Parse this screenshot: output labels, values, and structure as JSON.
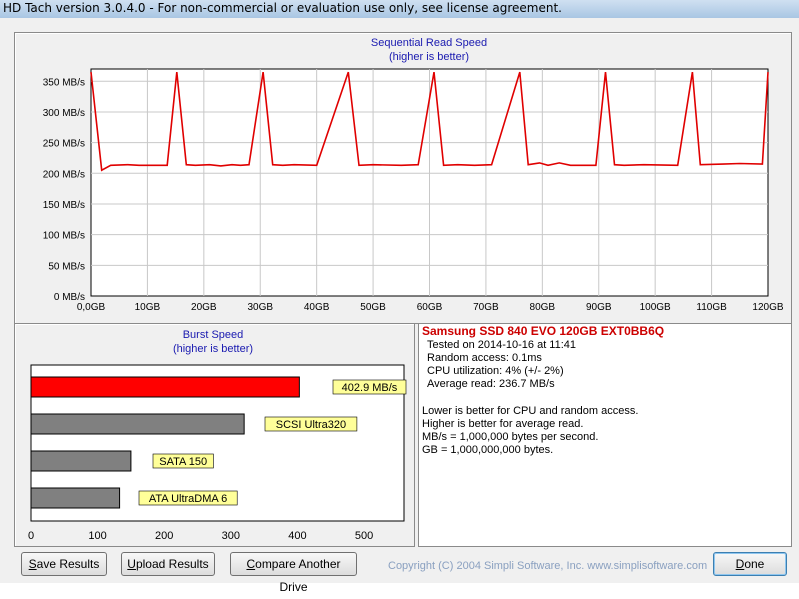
{
  "window": {
    "title": "HD Tach version 3.0.4.0  - For non-commercial or evaluation use only, see license agreement."
  },
  "sequential": {
    "title": "Sequential Read Speed",
    "subtitle": "(higher is better)"
  },
  "burst": {
    "title": "Burst Speed",
    "subtitle": "(higher is better)",
    "bars": [
      {
        "label": "402.9 MB/s",
        "value": 402.9,
        "color": "#ff0000"
      },
      {
        "label": "SCSI Ultra320",
        "value": 320,
        "color": "#808080"
      },
      {
        "label": "SATA 150",
        "value": 150,
        "color": "#808080"
      },
      {
        "label": "ATA UltraDMA 6",
        "value": 133,
        "color": "#808080"
      }
    ],
    "xticks": [
      "0",
      "100",
      "200",
      "300",
      "400",
      "500"
    ],
    "xmax": 560
  },
  "info": {
    "drive_name": "Samsung SSD 840 EVO 120GB EXT0BB6Q",
    "tested_on": "Tested on 2014-10-16 at 11:41",
    "random_access": "Random access: 0.1ms",
    "cpu_util": "CPU utilization: 4% (+/- 2%)",
    "average_read": "Average read: 236.7 MB/s",
    "note1": "Lower is better for CPU and random access.",
    "note2": "Higher is better for average read.",
    "note3": "MB/s = 1,000,000 bytes per second.",
    "note4": "GB = 1,000,000,000 bytes."
  },
  "buttons": {
    "save_prefix": "S",
    "save_rest": "ave Results",
    "upload_prefix": "U",
    "upload_rest": "pload Results",
    "compare_prefix": "C",
    "compare_rest": "ompare Another Drive",
    "done_prefix": "D",
    "done_rest": "one"
  },
  "copyright": "Copyright (C) 2004 Simpli Software, Inc. www.simplisoftware.com",
  "colors": {
    "line": "#e00000",
    "label_blue": "#1a1ab0",
    "burst_label_bg": "#ffff99"
  },
  "chart_data": [
    {
      "type": "line",
      "title": "Sequential Read Speed",
      "subtitle": "(higher is better)",
      "ylabel": "",
      "xlabel": "",
      "y_ticks": [
        "0 MB/s",
        "50 MB/s",
        "100 MB/s",
        "150 MB/s",
        "200 MB/s",
        "250 MB/s",
        "300 MB/s",
        "350 MB/s"
      ],
      "x_ticks": [
        "0,0GB",
        "10GB",
        "20GB",
        "30GB",
        "40GB",
        "50GB",
        "60GB",
        "70GB",
        "80GB",
        "90GB",
        "100GB",
        "110GB",
        "120GB"
      ],
      "xlim": [
        0,
        120
      ],
      "ylim": [
        0,
        370
      ],
      "grid": true,
      "series": [
        {
          "x": [
            0,
            1.9,
            3.5,
            6.5,
            8.5,
            13.5,
            15.2,
            16.9,
            18.5,
            21,
            23,
            25,
            26.5,
            28,
            30.5,
            32.2,
            34,
            36,
            40,
            45.6,
            47.5,
            50,
            55,
            58,
            60.8,
            62.5,
            65,
            68,
            71,
            76,
            77.5,
            79.5,
            81,
            83,
            85,
            89.5,
            91.2,
            92.8,
            94.5,
            98,
            104,
            106.6,
            108,
            112,
            115,
            119,
            120
          ],
          "y": [
            365,
            205,
            213,
            214,
            213,
            213,
            365,
            214,
            213,
            214,
            212,
            214,
            213,
            214,
            365,
            214,
            213,
            214,
            213,
            365,
            213,
            214,
            213,
            214,
            365,
            213,
            214,
            213,
            214,
            365,
            214,
            217,
            213,
            217,
            213,
            213,
            365,
            214,
            213,
            214,
            213,
            365,
            214,
            215,
            216,
            215,
            365
          ]
        }
      ]
    },
    {
      "type": "bar",
      "title": "Burst Speed",
      "subtitle": "(higher is better)",
      "orientation": "horizontal",
      "categories": [
        "402.9 MB/s",
        "SCSI Ultra320",
        "SATA 150",
        "ATA UltraDMA 6"
      ],
      "values": [
        402.9,
        320,
        150,
        133
      ],
      "x_ticks": [
        "0",
        "100",
        "200",
        "300",
        "400",
        "500"
      ],
      "xlim": [
        0,
        560
      ],
      "grid": false
    }
  ]
}
